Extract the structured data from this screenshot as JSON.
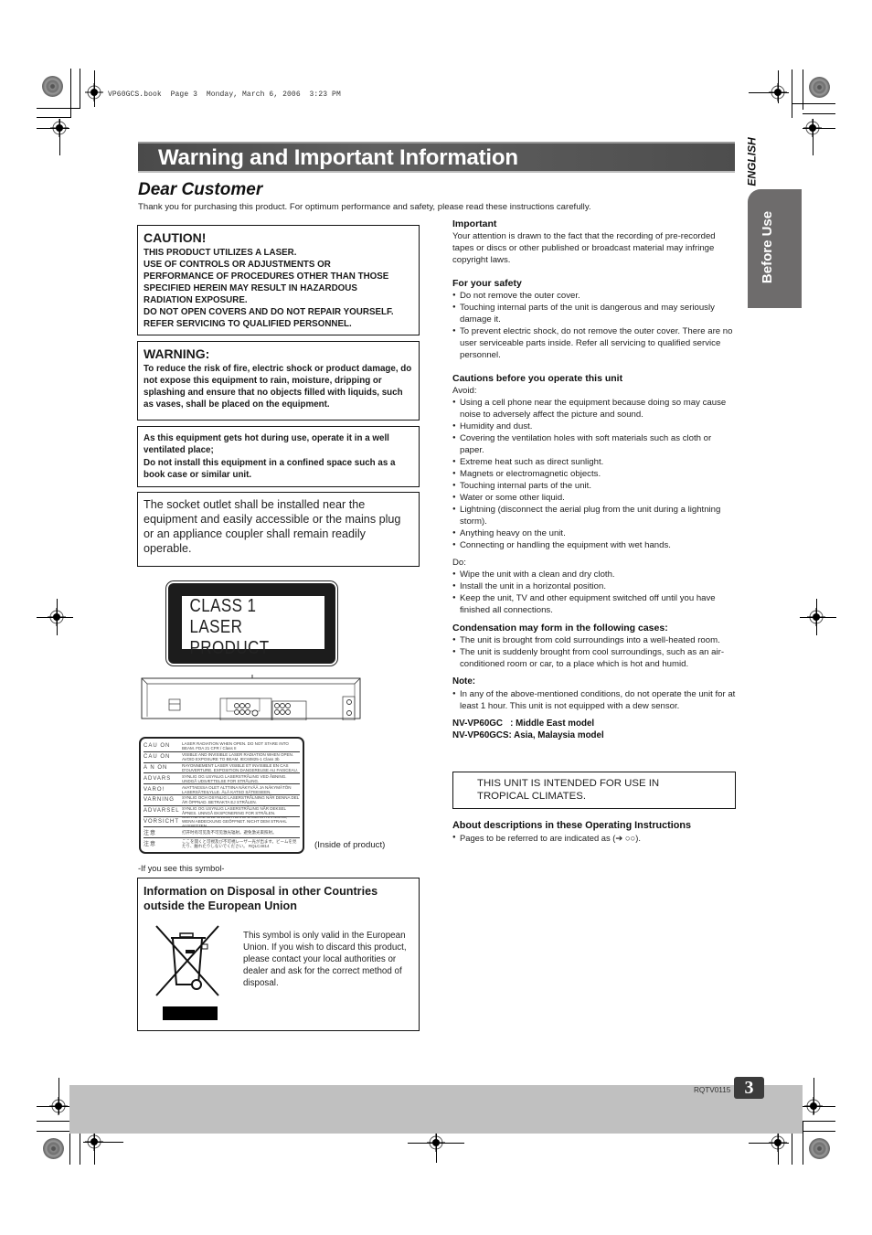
{
  "print_header": "VP60GCS.book  Page 3  Monday, March 6, 2006  3:23 PM",
  "side_tabs": {
    "language": "ENGLISH",
    "section": "Before Use"
  },
  "title": "Warning and Important Information",
  "dear_customer": {
    "heading": "Dear Customer",
    "intro": "Thank you for purchasing this product. For optimum performance and safety, please read these instructions carefully."
  },
  "caution_box": {
    "heading": "CAUTION!",
    "lines": [
      "THIS PRODUCT UTILIZES A LASER.",
      "USE OF CONTROLS OR ADJUSTMENTS OR",
      "PERFORMANCE OF PROCEDURES OTHER THAN THOSE",
      "SPECIFIED HEREIN MAY RESULT IN HAZARDOUS",
      "RADIATION EXPOSURE.",
      "DO NOT OPEN COVERS AND DO NOT REPAIR YOURSELF.",
      "REFER SERVICING TO QUALIFIED PERSONNEL."
    ]
  },
  "warning_box": {
    "heading": "WARNING:",
    "text": "To reduce the risk of fire, electric shock or product damage, do not expose this equipment to rain, moisture, dripping or splashing and ensure that no objects filled with liquids, such as vases, shall be placed on the equipment."
  },
  "heat_box": {
    "line1": "As this equipment gets hot during use, operate it in a well ventilated place;",
    "line2": "Do not install this equipment in a confined space such as a book case or similar unit."
  },
  "socket_box": {
    "text": "The socket outlet shall be installed near the equipment and easily accessible or the mains plug or an appliance coupler shall remain readily operable."
  },
  "laser_label": {
    "line1": "CLASS 1",
    "line2": "LASER PRODUCT"
  },
  "inside_label": {
    "rows": [
      {
        "key": "CAU  ON",
        "text": "LASER RADIATION WHEN OPEN. DO NOT STARE INTO BEAM.  FDA 21 CFR / Class II"
      },
      {
        "key": "CAU  ON",
        "text": "VISIBLE AND INVISIBLE LASER RADIATION WHEN OPEN. AVOID EXPOSURE TO BEAM.  IEC60825-1 Class 3b"
      },
      {
        "key": "A  N  ON",
        "text": "RAYONNEMENT LASER VISIBLE ET INVISIBLE EN CAS D'OUVERTURE. EXPOSITION DANGEREUSE AU FAISCEAU."
      },
      {
        "key": "ADVARS",
        "text": "SYNLIG OG USYNLIG LASERSTRÅLING VED ÅBNING. UNDGÅ UDSÆTTELSE FOR STRÅLING."
      },
      {
        "key": "VARO!",
        "text": "AVATTAESSA OLET ALTTIINA NÄKYVÄÄ JA NÄKYMÄTÖN LASERSÄTEILYLLE. ÄLÄ KATSO SÄTEESEEN."
      },
      {
        "key": "VARNING",
        "text": "SYNLIG OCH OSYNLIG LASERSTRÅLNING NÄR DENNA DEL ÄR ÖPPNAD. BETRAKTA EJ STRÅLEN."
      },
      {
        "key": "ADVARSEL",
        "text": "SYNLIG OG USYNLIG LASERSTRÅLING NÅR DEKSEL ÅPNES. UNNGÅ EKSPONERING FOR STRÅLEN."
      },
      {
        "key": "VORSICHT",
        "text": "SICHTBARE UND UNSICHTBARE LASERSTRAHLUNG, WENN ABDECKUNG GEÖFFNET. NICHT DEM STRAHL AUSSETZEN."
      },
      {
        "key": "注意",
        "text": "打开时有可见及不可见激光辐射。避免激光束照射。"
      },
      {
        "key": "注意",
        "text": "ここを開くと可視及び不可視レーザー光が出ます。ビームを見たり、触れたりしないでください。  RQLC4814"
      }
    ],
    "caption": "(Inside of product)"
  },
  "symbol_note": "-If you see this symbol-",
  "disposal_box": {
    "heading": "Information on Disposal in other Countries outside the European Union",
    "text": "This symbol is only valid in the European Union. If you wish to discard this product, please contact your local authorities or dealer and ask for the correct method of disposal."
  },
  "right_column": {
    "important": {
      "heading": "Important",
      "text": "Your attention is drawn to the fact that the recording of pre-recorded tapes or discs or other published or broadcast material may infringe copyright laws."
    },
    "safety": {
      "heading": "For your safety",
      "items": [
        "Do not remove the outer cover.",
        "Touching internal parts of the unit is dangerous and may seriously damage it.",
        "To prevent electric shock, do not remove the outer cover. There are no user serviceable parts inside. Refer all servicing to qualified service personnel."
      ]
    },
    "cautions": {
      "heading": "Cautions before you operate this unit",
      "avoid_label": "Avoid:",
      "avoid_items": [
        "Using a cell phone near the equipment because doing so may cause noise to adversely affect the picture and sound.",
        "Humidity and dust.",
        "Covering the ventilation holes with soft materials such as cloth or paper.",
        "Extreme heat such as direct sunlight.",
        "Magnets or electromagnetic objects.",
        "Touching internal parts of the unit.",
        "Water or some other liquid.",
        "Lightning (disconnect the aerial plug from the unit during a lightning storm).",
        "Anything heavy on the unit.",
        "Connecting or handling the equipment with wet hands."
      ],
      "do_label": "Do:",
      "do_items": [
        "Wipe the unit with a clean and dry cloth.",
        "Install the unit in a horizontal position.",
        "Keep the unit, TV and other equipment switched off until you have finished all connections."
      ]
    },
    "condensation": {
      "heading": "Condensation may form in the following cases:",
      "items": [
        "The unit is brought from cold surroundings into a well-heated room.",
        "The unit is suddenly brought from cool surroundings, such as an air-conditioned room or car, to a place which is hot and humid."
      ]
    },
    "note": {
      "heading": "Note:",
      "items": [
        "In any of the above-mentioned conditions, do not operate the unit for at least 1 hour. This unit is not equipped with a dew sensor."
      ]
    },
    "models": [
      "NV-VP60GC   : Middle East model",
      "NV-VP60GCS: Asia, Malaysia model"
    ],
    "tropical": "THIS UNIT IS INTENDED FOR USE IN TROPICAL CLIMATES.",
    "about": {
      "heading": "About descriptions in these Operating Instructions",
      "items": [
        "Pages to be referred to are indicated as (➔ ○○)."
      ]
    }
  },
  "footer": {
    "code": "RQTV0115",
    "page_number": "3"
  },
  "icons": {
    "registration_mark": "crosshair-circle",
    "disposal_symbol": "crossed-out-wheelie-bin"
  }
}
